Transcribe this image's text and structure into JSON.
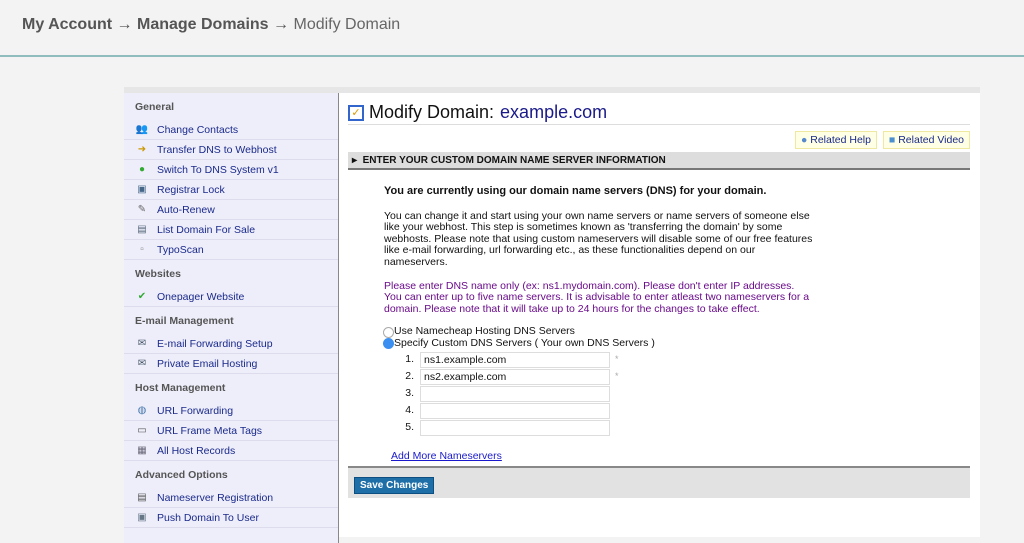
{
  "breadcrumb": {
    "items": [
      "My Account",
      "Manage Domains",
      "Modify Domain"
    ],
    "separator": "→"
  },
  "sidebar": {
    "sections": [
      {
        "title": "General",
        "items": [
          {
            "label": "Change Contacts",
            "icon": "contacts-icon"
          },
          {
            "label": "Transfer DNS to Webhost",
            "icon": "arrow-right-icon"
          },
          {
            "label": "Switch To DNS System v1",
            "icon": "switch-icon"
          },
          {
            "label": "Registrar Lock",
            "icon": "lock-icon"
          },
          {
            "label": "Auto-Renew",
            "icon": "renew-icon"
          },
          {
            "label": "List Domain For Sale",
            "icon": "list-icon"
          },
          {
            "label": "TypoScan",
            "icon": "typoscan-icon"
          }
        ]
      },
      {
        "title": "Websites",
        "items": [
          {
            "label": "Onepager Website",
            "icon": "check-icon"
          }
        ]
      },
      {
        "title": "E-mail Management",
        "items": [
          {
            "label": "E-mail Forwarding Setup",
            "icon": "email-forward-icon"
          },
          {
            "label": "Private Email Hosting",
            "icon": "email-icon"
          }
        ]
      },
      {
        "title": "Host Management",
        "items": [
          {
            "label": "URL Forwarding",
            "icon": "globe-icon"
          },
          {
            "label": "URL Frame Meta Tags",
            "icon": "frame-icon"
          },
          {
            "label": "All Host Records",
            "icon": "records-icon"
          }
        ]
      },
      {
        "title": "Advanced Options",
        "items": [
          {
            "label": "Nameserver Registration",
            "icon": "nameserver-icon"
          },
          {
            "label": "Push Domain To User",
            "icon": "push-icon"
          }
        ]
      }
    ]
  },
  "main": {
    "title": "Modify Domain:",
    "domain": "example.com",
    "related_help": "Related Help",
    "related_video": "Related Video",
    "section_title": "ENTER YOUR CUSTOM DOMAIN NAME SERVER INFORMATION",
    "status": "You are currently using our domain name servers (DNS) for your domain.",
    "info": "You can change it and start using your own name servers or name servers of someone else like your webhost. This step is sometimes known as 'transferring the domain' by some webhosts. Please note that using custom nameservers will disable some of our free features like e-mail forwarding, url forwarding etc., as these functionalities depend on our nameservers.",
    "note": "Please enter DNS name only (ex: ns1.mydomain.com). Please don't enter IP addresses. You can enter up to five name servers. It is advisable to enter atleast two nameservers for a domain. Please note that it will take up to 24 hours for the changes to take effect.",
    "options": [
      {
        "label": "Use Namecheap Hosting DNS Servers",
        "selected": false
      },
      {
        "label": "Specify Custom DNS Servers ( Your own DNS Servers )",
        "selected": true
      }
    ],
    "nameservers": [
      {
        "n": "1.",
        "value": "ns1.example.com",
        "req": "*"
      },
      {
        "n": "2.",
        "value": "ns2.example.com",
        "req": "*"
      },
      {
        "n": "3.",
        "value": ""
      },
      {
        "n": "4.",
        "value": ""
      },
      {
        "n": "5.",
        "value": ""
      }
    ],
    "add_more": "Add More Nameservers",
    "save": "Save Changes"
  }
}
